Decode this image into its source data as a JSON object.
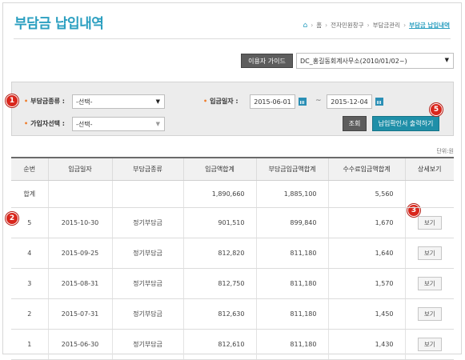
{
  "header": {
    "title": "부담금 납입내역",
    "breadcrumb": [
      "홈",
      "전자민원창구",
      "부담금관리",
      "부담금 납입내역"
    ]
  },
  "toolbar": {
    "guide_label": "이용자 가이드",
    "office_selected": "DC_홍길동회계사무소(2010/01/02~)"
  },
  "search": {
    "type_label": "부담금종류 :",
    "type_value": "-선택-",
    "member_label": "가입자선택 :",
    "member_value": "-선택-",
    "date_label": "입금일자 :",
    "date_from": "2015-06-01",
    "date_to": "2015-12-04",
    "date_sep": "~",
    "search_label": "조회",
    "print_label": "납입확인서 출력하기"
  },
  "markers": [
    "1",
    "2",
    "3",
    "5"
  ],
  "unit": "단위:원",
  "table": {
    "headers": [
      "순번",
      "입금일자",
      "부담금종류",
      "입금액합계",
      "부담금입금액합계",
      "수수료입금액합계",
      "상세보기"
    ],
    "total": {
      "label": "합계",
      "amount": "1,890,660",
      "contribution": "1,885,100",
      "fee": "5,560"
    },
    "view_label": "보기",
    "rows": [
      {
        "no": "5",
        "date": "2015-10-30",
        "type": "정기부담금",
        "amount": "901,510",
        "contribution": "899,840",
        "fee": "1,670"
      },
      {
        "no": "4",
        "date": "2015-09-25",
        "type": "정기부담금",
        "amount": "812,820",
        "contribution": "811,180",
        "fee": "1,640"
      },
      {
        "no": "3",
        "date": "2015-08-31",
        "type": "정기부담금",
        "amount": "812,750",
        "contribution": "811,180",
        "fee": "1,570"
      },
      {
        "no": "2",
        "date": "2015-07-31",
        "type": "정기부담금",
        "amount": "812,630",
        "contribution": "811,180",
        "fee": "1,450"
      },
      {
        "no": "1",
        "date": "2015-06-30",
        "type": "정기부담금",
        "amount": "812,610",
        "contribution": "811,180",
        "fee": "1,430"
      }
    ]
  },
  "colors": {
    "accent": "#2b9fc0",
    "marker": "#d9261c",
    "print_button": "#1f8fa8"
  }
}
